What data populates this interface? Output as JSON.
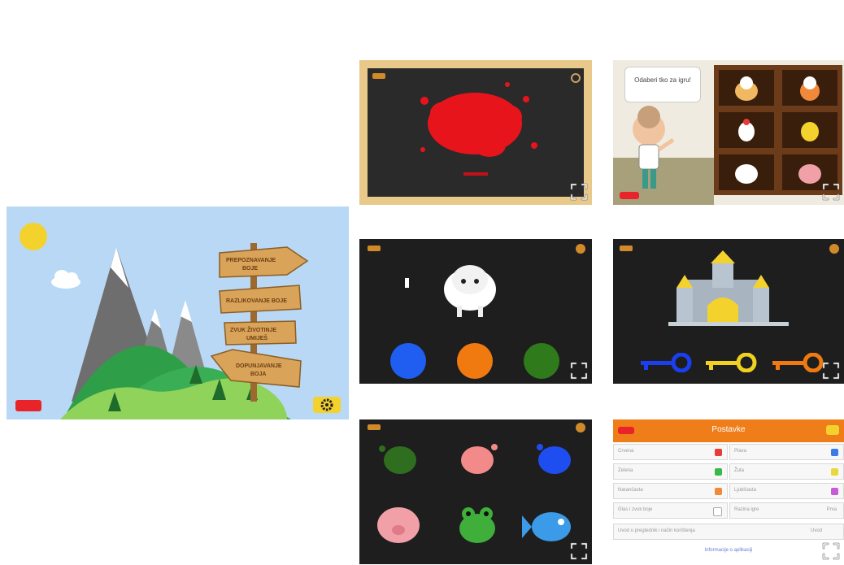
{
  "title_screen": {
    "signs": [
      {
        "line1": "PREPOZNAVANJE",
        "line2": "BOJE"
      },
      {
        "line1": "RAZLIKOVANJE BOJE",
        "line2": ""
      },
      {
        "line1": "ZVUK ŽIVOTINJE",
        "line2": "UMIJEŠ"
      },
      {
        "line1": "DOPUNJAVANJE",
        "line2": "BOJA"
      }
    ]
  },
  "paint_game": {
    "splat_color": "#e8141c"
  },
  "animal_shelf": {
    "speech": "Odaberi tko za igru!",
    "animals": [
      "cow",
      "cat",
      "chicken",
      "chick",
      "sheep",
      "pig"
    ]
  },
  "sheep_game": {
    "choices": [
      "#1f5ef0",
      "#f07a10",
      "#2f7a1a"
    ]
  },
  "castle_game": {
    "keys": [
      "#1b3ff0",
      "#f0d020",
      "#f07a10"
    ]
  },
  "splat_match": {
    "splats": [
      "#2e6e1e",
      "#f28a8a",
      "#1f4ef0"
    ],
    "animals": [
      "pig",
      "frog",
      "fish"
    ]
  },
  "settings_screen": {
    "title": "Postavke",
    "rows": [
      {
        "label": "Crvena",
        "color": "#e83b3b"
      },
      {
        "label": "Plava",
        "color": "#3b7be8"
      },
      {
        "label": "Zelena",
        "color": "#3bb84a"
      },
      {
        "label": "Žuta",
        "color": "#e8d83b"
      },
      {
        "label": "Narančasta",
        "color": "#ee8a3b"
      },
      {
        "label": "Ljubičasta",
        "color": "#c85bd8"
      }
    ],
    "row_sound": "Glas i zvuk boje",
    "row_level": "Razina igre",
    "row_level_value": "Prva",
    "row_intro": "Uvod u preglednik i način korištenja",
    "row_intro_value": "Uvod",
    "footer_link": "Informacije o aplikaciji"
  }
}
